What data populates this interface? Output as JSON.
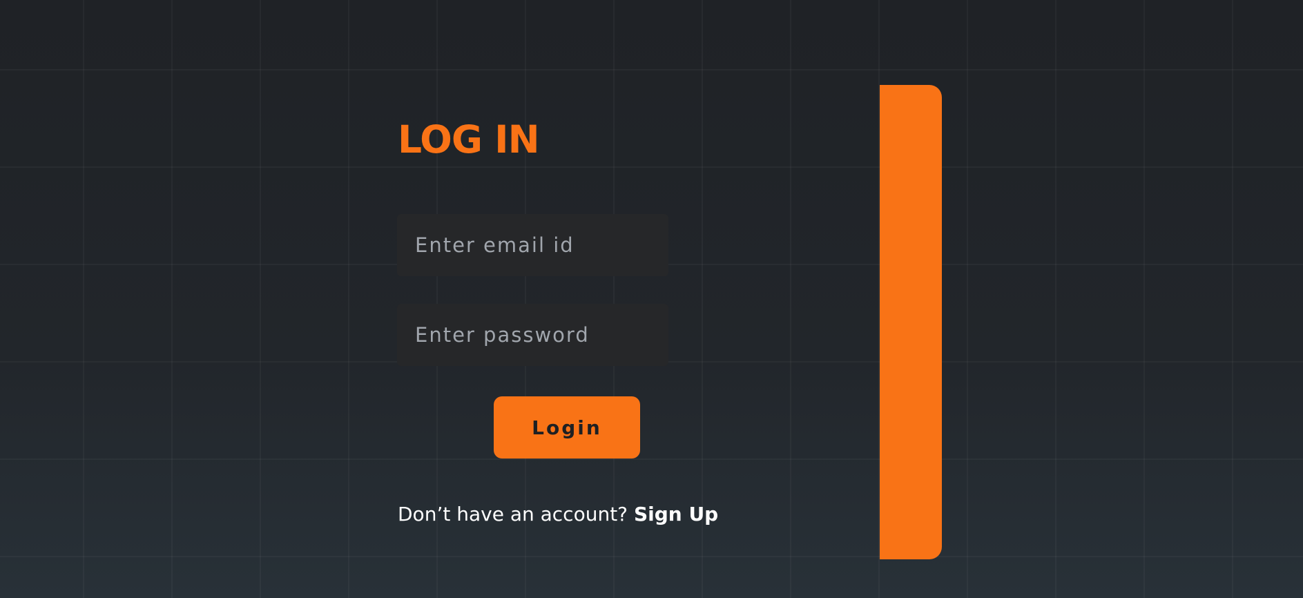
{
  "login_form": {
    "title": "LOG IN",
    "email_placeholder": "Enter email id",
    "password_placeholder": "Enter password",
    "submit_label": "Login",
    "signup_prompt": "Don’t have an account?",
    "signup_link": "Sign Up"
  },
  "theme": {
    "accent": "#f97316",
    "background": "#22262b",
    "input_background": "#262729"
  }
}
